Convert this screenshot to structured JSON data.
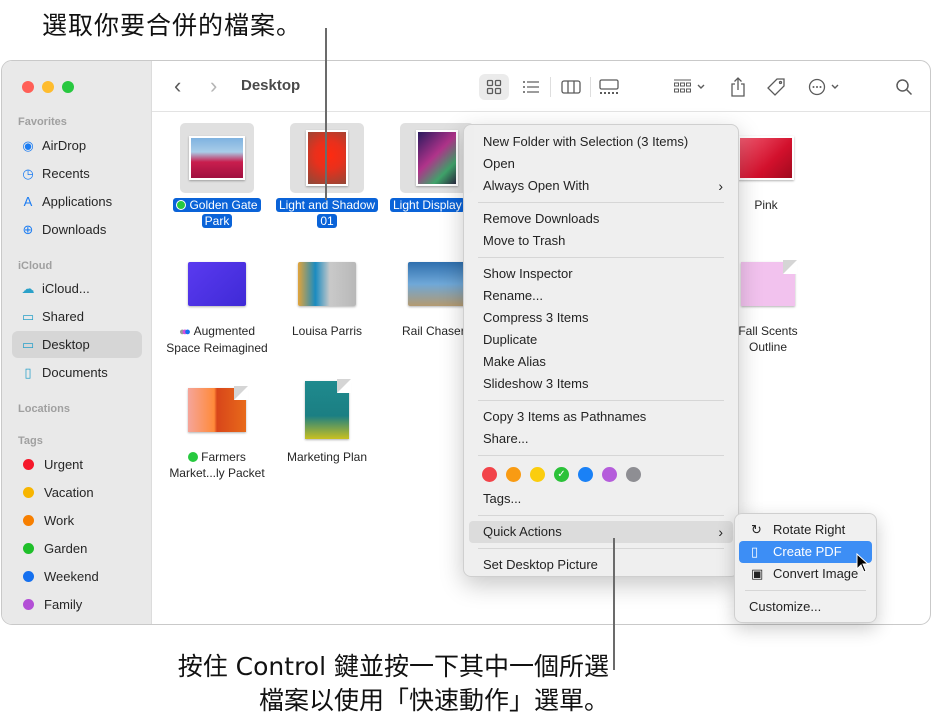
{
  "callouts": {
    "top": "選取你要合併的檔案。",
    "bottom_line1": "按住 Control 鍵並按一下其中一個所選",
    "bottom_line2": "檔案以使用「快速動作」選單。"
  },
  "window": {
    "traffic_lights": {
      "close": "#ff5f57",
      "minimize": "#febc2e",
      "zoom": "#28c840"
    },
    "title": "Desktop"
  },
  "sidebar": {
    "sections": {
      "favorites": "Favorites",
      "icloud": "iCloud",
      "locations": "Locations",
      "tags": "Tags"
    },
    "favorites": [
      {
        "label": "AirDrop",
        "icon": "airdrop-icon"
      },
      {
        "label": "Recents",
        "icon": "clock-icon"
      },
      {
        "label": "Applications",
        "icon": "applications-icon"
      },
      {
        "label": "Downloads",
        "icon": "download-icon"
      }
    ],
    "icloud": [
      {
        "label": "iCloud...",
        "icon": "cloud-icon"
      },
      {
        "label": "Shared",
        "icon": "shared-folder-icon"
      },
      {
        "label": "Desktop",
        "icon": "desktop-icon",
        "active": true
      },
      {
        "label": "Documents",
        "icon": "document-icon"
      }
    ],
    "tags": [
      {
        "label": "Urgent",
        "color": "#f5182a"
      },
      {
        "label": "Vacation",
        "color": "#f7b500"
      },
      {
        "label": "Work",
        "color": "#f77f00"
      },
      {
        "label": "Garden",
        "color": "#1fbf2a"
      },
      {
        "label": "Weekend",
        "color": "#1570ef"
      },
      {
        "label": "Family",
        "color": "#b34fd6"
      }
    ]
  },
  "toolbar": {
    "back": "‹",
    "forward": "›",
    "views": [
      "icon-view",
      "list-view",
      "column-view",
      "gallery-view"
    ],
    "active_view": "icon-view"
  },
  "files": [
    {
      "name_line1": "Golden Gate",
      "name_line2": "Park",
      "selected": true,
      "tag": "#27c93f"
    },
    {
      "name_line1": "Light and Shadow",
      "name_line2": "01",
      "selected": true
    },
    {
      "name_line1": "Light Display",
      "name_line2": "",
      "selected": true
    },
    {
      "name_line1": "Pink",
      "name_line2": ""
    },
    {
      "name_line1": "Augmented",
      "name_line2": "Space Reimagined",
      "multi_tag": true
    },
    {
      "name_line1": "Louisa Parris",
      "name_line2": ""
    },
    {
      "name_line1": "Rail Chaser",
      "name_line2": ""
    },
    {
      "name_line1": "Fall Scents",
      "name_line2": "Outline"
    },
    {
      "name_line1": "Farmers",
      "name_line2": "Market...ly Packet",
      "tag": "#27c93f"
    },
    {
      "name_line1": "Marketing Plan",
      "name_line2": ""
    }
  ],
  "context_menu": {
    "items": [
      "New Folder with Selection (3 Items)",
      "Open",
      "Always Open With",
      "Remove Downloads",
      "Move to Trash",
      "Show Inspector",
      "Rename...",
      "Compress 3 Items",
      "Duplicate",
      "Make Alias",
      "Slideshow 3 Items",
      "Copy 3 Items as Pathnames",
      "Share...",
      "Tags...",
      "Quick Actions",
      "Set Desktop Picture"
    ],
    "tag_colors": [
      "#f2444a",
      "#f99b13",
      "#fbcd0e",
      "#2bc239",
      "#1a81f6",
      "#b55ddb",
      "#8e8e93"
    ],
    "checked_tag_index": 3,
    "submenu_arrow": "›"
  },
  "quick_actions_submenu": {
    "items": [
      "Rotate Right",
      "Create PDF",
      "Convert Image",
      "Customize..."
    ],
    "highlighted": "Create PDF"
  }
}
